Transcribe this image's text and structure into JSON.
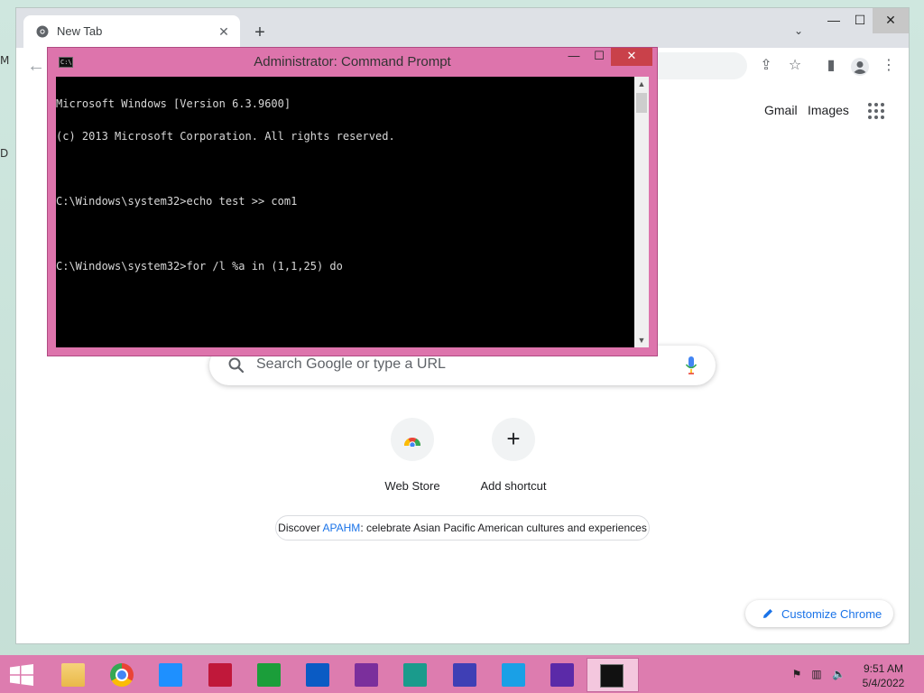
{
  "desktop": {
    "left_labels": [
      "M",
      "D"
    ]
  },
  "chrome": {
    "tab": {
      "title": "New Tab",
      "close": "✕"
    },
    "new_tab_symbol": "+",
    "tab_search_symbol": "⌄",
    "window_controls": {
      "minimize": "—",
      "maximize": "☐",
      "close": "✕"
    },
    "toolbar": {
      "back": "←",
      "icons": [
        "share-icon",
        "star-icon",
        "sidepanel-icon",
        "profile-icon",
        "menu-icon"
      ],
      "symbols": {
        "share": "⇪",
        "star": "☆",
        "sidepanel": "▮",
        "menu": "⋮"
      }
    },
    "top_links": {
      "gmail": "Gmail",
      "images": "Images"
    },
    "search": {
      "placeholder": "Search Google or type a URL"
    },
    "shortcuts": [
      {
        "label": "Web Store",
        "icon": "web-store-icon"
      },
      {
        "label": "Add shortcut",
        "icon": "plus-icon",
        "symbol": "+"
      }
    ],
    "promo": {
      "prefix": "Discover ",
      "link": "APAHM",
      "suffix": ": celebrate Asian Pacific American cultures and experiences"
    },
    "customize": {
      "label": "Customize Chrome"
    }
  },
  "cmd": {
    "title": "Administrator: Command Prompt",
    "icon_text": "C:\\",
    "controls": {
      "minimize": "—",
      "maximize": "☐",
      "close": "✕"
    },
    "lines": [
      "Microsoft Windows [Version 6.3.9600]",
      "(c) 2013 Microsoft Corporation. All rights reserved.",
      "",
      "C:\\Windows\\system32>echo test >> com1",
      "",
      "C:\\Windows\\system32>for /l %a in (1,1,25) do"
    ]
  },
  "taskbar": {
    "apps": [
      {
        "name": "file-explorer",
        "color": "#e9b949"
      },
      {
        "name": "chrome",
        "color": "#4285f4"
      },
      {
        "name": "weather",
        "color": "#1e90ff"
      },
      {
        "name": "video",
        "color": "#c0183a"
      },
      {
        "name": "xbox-games",
        "color": "#1b9e3a"
      },
      {
        "name": "onedrive",
        "color": "#0a5bc4"
      },
      {
        "name": "onenote",
        "color": "#7b2f9c"
      },
      {
        "name": "food-drink",
        "color": "#1a9b8c"
      },
      {
        "name": "settings",
        "color": "#3f3fb5"
      },
      {
        "name": "skype",
        "color": "#1aa0e6"
      },
      {
        "name": "achievements",
        "color": "#5b2aa8"
      },
      {
        "name": "command-prompt",
        "color": "#111111"
      }
    ],
    "tray_symbols": {
      "flag": "⚑",
      "network": "▥",
      "volume": "🔈"
    },
    "clock": {
      "time": "9:51 AM",
      "date": "5/4/2022"
    }
  },
  "colors": {
    "cmd_frame": "#dd74ac",
    "taskbar": "#dd7caf",
    "link_blue": "#1a73e8"
  }
}
